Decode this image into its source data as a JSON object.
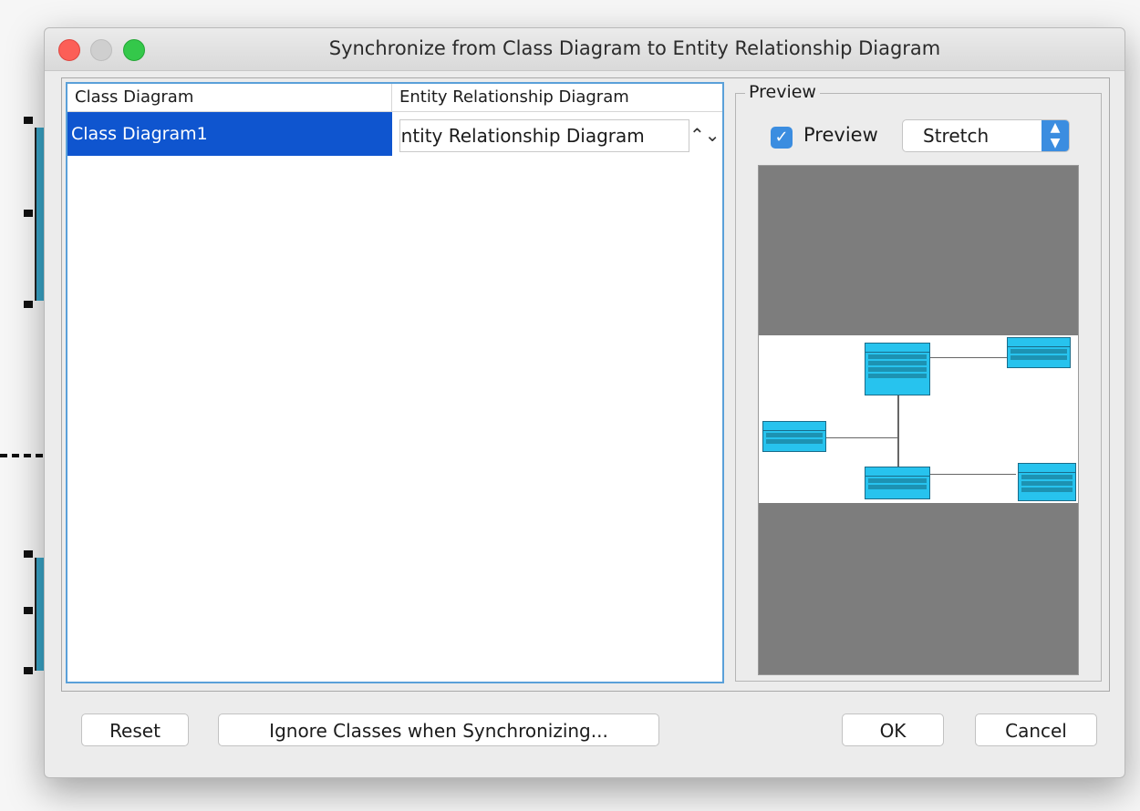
{
  "window": {
    "title": "Synchronize from Class Diagram to Entity Relationship Diagram"
  },
  "table": {
    "columns": [
      "Class Diagram",
      "Entity Relationship Diagram"
    ],
    "rows": [
      {
        "class_diagram": "Class Diagram1",
        "er_diagram": "Entity Relationship Diagram"
      }
    ]
  },
  "preview": {
    "group_label": "Preview",
    "checkbox_label": "Preview",
    "checkbox_checked": true,
    "mode_value": "Stretch"
  },
  "footer": {
    "reset_label": "Reset",
    "ignore_label": "Ignore Classes when Synchronizing...",
    "ok_label": "OK",
    "cancel_label": "Cancel"
  },
  "colors": {
    "selection": "#0f55cf",
    "accent": "#3b8de0",
    "class_fill": "#27c3ee"
  },
  "icons": {
    "checkbox": "checkmark-icon",
    "select": "chevron-updown-icon"
  }
}
